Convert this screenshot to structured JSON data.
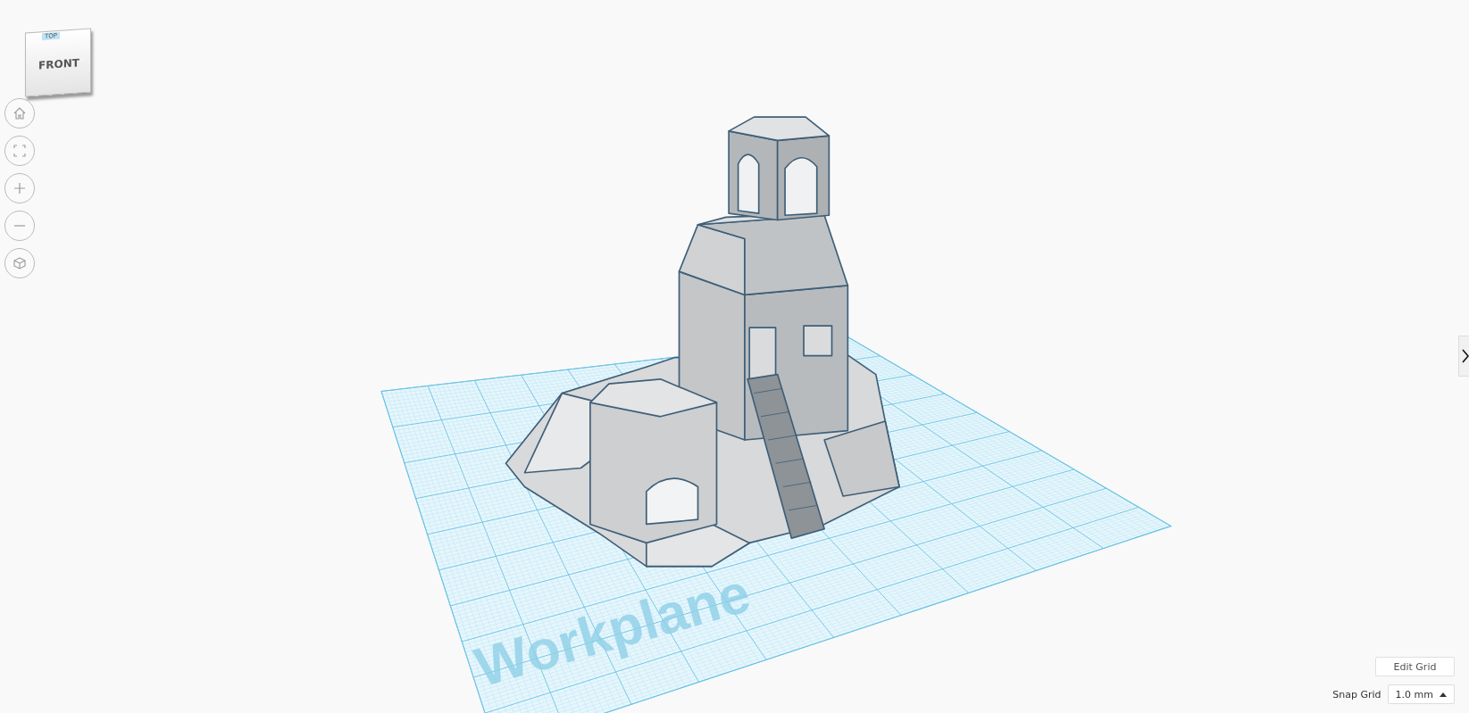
{
  "view_cube": {
    "top_label": "TOP",
    "front_label": "FRONT"
  },
  "workplane": {
    "label": "Workplane"
  },
  "edit_grid_button": {
    "label": "Edit Grid"
  },
  "snap_grid": {
    "label": "Snap Grid",
    "value": "1.0 mm"
  }
}
